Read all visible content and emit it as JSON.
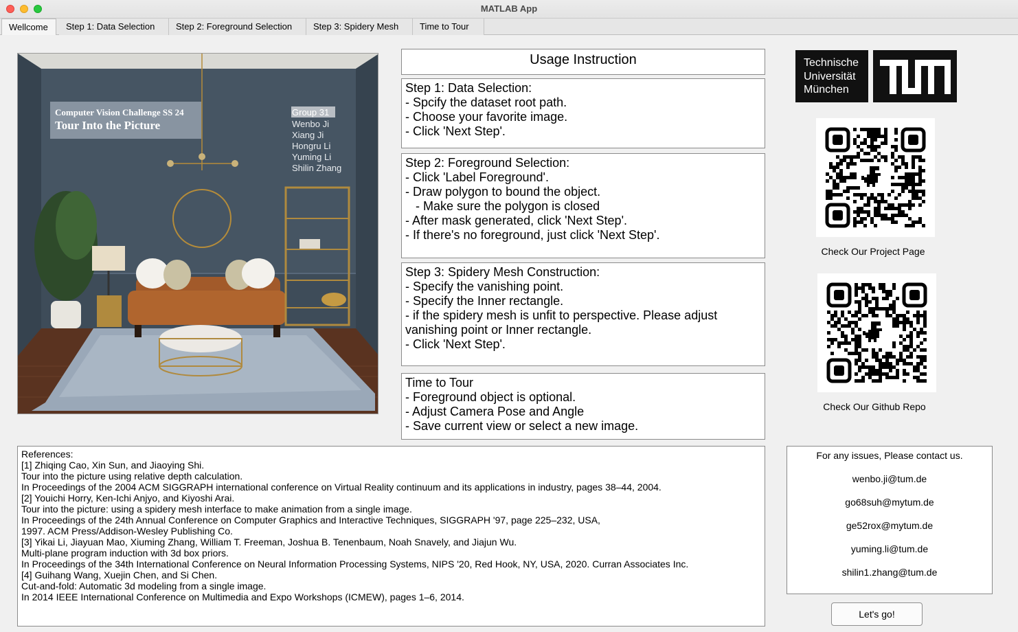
{
  "window": {
    "title": "MATLAB App"
  },
  "tabs": [
    {
      "label": "Wellcome",
      "active": true
    },
    {
      "label": "Step 1: Data Selection",
      "active": false
    },
    {
      "label": "Step 2: Foreground Selection",
      "active": false
    },
    {
      "label": "Step 3: Spidery Mesh",
      "active": false
    },
    {
      "label": "Time to Tour",
      "active": false
    }
  ],
  "photo": {
    "banner_line1": "Computer Vision Challenge SS 24",
    "banner_line2": "Tour Into the Picture",
    "group": "Group 31",
    "members": [
      "Wenbo Ji",
      "Xiang Ji",
      "Hongru Li",
      "Yuming Li",
      "Shilin Zhang"
    ]
  },
  "usage": {
    "title": "Usage Instruction",
    "step1": "Step 1: Data Selection:\n- Spcify the dataset root path.\n- Choose your favorite image.\n- Click 'Next Step'.",
    "step2": "Step 2: Foreground Selection:\n- Click 'Label Foreground'.\n- Draw polygon to bound the object.\n   - Make sure the polygon is closed\n- After mask generated, click 'Next Step'.\n- If there's no foreground, just click 'Next Step'.",
    "step3": "Step 3: Spidery Mesh Construction:\n- Specify the vanishing point.\n- Specify the Inner rectangle.\n- if the spidery mesh is unfit to perspective. Please adjust\nvanishing point or Inner rectangle.\n- Click 'Next Step'.",
    "tour": "Time to Tour\n- Foreground object is optional.\n- Adjust Camera Pose and Angle\n- Save current view or select a new image."
  },
  "references": "References:\n[1] Zhiqing Cao, Xin Sun, and Jiaoying Shi.\nTour into the picture using relative depth calculation.\nIn Proceedings of the 2004 ACM SIGGRAPH international conference on Virtual Reality continuum and its applications in industry, pages 38–44, 2004.\n[2] Youichi Horry, Ken-Ichi Anjyo, and Kiyoshi Arai.\nTour into the picture: using a spidery mesh interface to make animation from a single image.\nIn Proceedings of the 24th Annual Conference on Computer Graphics and Interactive Techniques, SIGGRAPH '97, page 225–232, USA,\n1997. ACM Press/Addison-Wesley Publishing Co.\n[3] Yikai Li, Jiayuan Mao, Xiuming Zhang, William T. Freeman, Joshua B. Tenenbaum, Noah Snavely, and Jiajun Wu.\nMulti-plane program induction with 3d box priors.\nIn Proceedings of the 34th International Conference on Neural Information Processing Systems, NIPS '20, Red Hook, NY, USA, 2020. Curran Associates Inc.\n[4] Guihang Wang, Xuejin Chen, and Si Chen.\nCut-and-fold: Automatic 3d modeling from a single image.\nIn 2014 IEEE International Conference on Multimedia and Expo Workshops (ICMEW), pages 1–6, 2014.",
  "logo": {
    "text": "Technische\nUniversität\nMünchen"
  },
  "qr1": {
    "caption": "Check Our Project Page"
  },
  "qr2": {
    "caption": "Check Our Github Repo"
  },
  "contact": {
    "heading": "For any issues, Please contact us.",
    "emails": [
      "wenbo.ji@tum.de",
      "go68suh@mytum.de",
      "ge52rox@mytum.de",
      "yuming.li@tum.de",
      "shilin1.zhang@tum.de"
    ]
  },
  "action": {
    "go_label": "Let's go!"
  }
}
